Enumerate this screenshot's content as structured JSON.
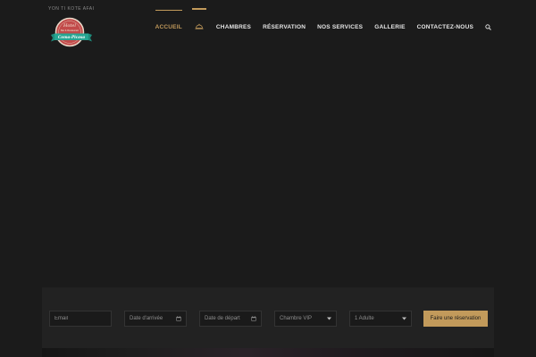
{
  "header": {
    "tagline": "YON TI KOTE AFAI",
    "logo": {
      "line1": "Hotel",
      "line2": "Bar & Restaurant",
      "ribbon": "Coma-Picasa"
    }
  },
  "nav": {
    "items": [
      {
        "label": "ACCUEIL",
        "active": true
      },
      {
        "label": "CHAMBRES",
        "active": false
      },
      {
        "label": "RÉSERVATION",
        "active": false
      },
      {
        "label": "NOS SERVICES",
        "active": false
      },
      {
        "label": "GALLERIE",
        "active": false
      },
      {
        "label": "CONTACTEZ-NOUS",
        "active": false
      }
    ],
    "accent_color": "#c29a5b"
  },
  "booking": {
    "email_placeholder": "Email",
    "arrival_placeholder": "Date d'arrivée",
    "departure_placeholder": "Date de départ",
    "room_selected": "Chambre VIP",
    "guests_selected": "1 Adulte",
    "submit_label": "Faire une réservation"
  }
}
